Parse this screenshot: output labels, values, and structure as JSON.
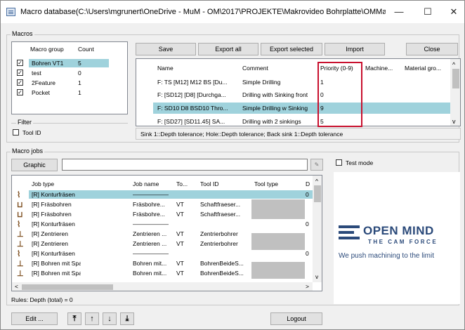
{
  "window": {
    "title": "Macro database(C:\\Users\\mgrunert\\OneDrive - MuM - OM\\2017\\PROJEKTE\\Makrovideo Bohrplatte\\OMMacr...",
    "minimize": "—",
    "maximize": "☐",
    "close": "✕"
  },
  "macros": {
    "label": "Macros",
    "columns": [
      "Macro group",
      "Count"
    ],
    "groups": [
      {
        "name": "Bohren VT1",
        "count": "5",
        "checked": true
      },
      {
        "name": "test",
        "count": "0",
        "checked": true
      },
      {
        "name": "2Feature",
        "count": "1",
        "checked": true
      },
      {
        "name": "Pocket",
        "count": "1",
        "checked": true
      }
    ]
  },
  "filter": {
    "label": "Filter",
    "tool_id": "Tool ID"
  },
  "toolbar": {
    "save": "Save",
    "export_all": "Export all",
    "export_selected": "Export selected",
    "import": "Import",
    "close": "Close"
  },
  "macro_table": {
    "columns": [
      "Name",
      "Comment",
      "Priority (0-9)",
      "Machine...",
      "Material gro..."
    ],
    "rows": [
      {
        "name": "F: TS [M12] M12 BS [Du...",
        "comment": "Simple Drilling",
        "priority": "1"
      },
      {
        "name": "F: [SD12] [D8] [Durchga...",
        "comment": "Drilling with Sinking front",
        "priority": "0"
      },
      {
        "name": "F: SD10 D8 BSD10 Thro...",
        "comment": "Simple Drilling w Sinking",
        "priority": "9"
      },
      {
        "name": "F: [SD27] [SD11.45] SA...",
        "comment": "Drilling with 2 sinkings",
        "priority": "5"
      }
    ],
    "status": "Sink 1::Depth tolerance; Hole::Depth tolerance; Back sink 1::Depth tolerance"
  },
  "macro_jobs": {
    "label": "Macro jobs",
    "graphic_button": "Graphic",
    "columns": [
      "Job type",
      "Job name",
      "To...",
      "Tool ID",
      "Tool type",
      "D"
    ],
    "rows": [
      {
        "type": "[R] Konturfräsen",
        "name": "——————",
        "to": "",
        "tool_id": "",
        "tool_type": "",
        "d": "0",
        "icon": "contour-milling-icon"
      },
      {
        "type": "[R] Fräsbohren",
        "name": "Fräsbohre...",
        "to": "VT",
        "tool_id": "Schaftfraeser...",
        "tool_type": "",
        "d": "",
        "icon": "mill-drilling-icon"
      },
      {
        "type": "[R] Fräsbohren",
        "name": "Fräsbohre...",
        "to": "VT",
        "tool_id": "Schaftfraeser...",
        "tool_type": "",
        "d": "",
        "icon": "mill-drilling-icon"
      },
      {
        "type": "[R] Konturfräsen",
        "name": "——————",
        "to": "",
        "tool_id": "",
        "tool_type": "",
        "d": "0",
        "icon": "contour-milling-icon"
      },
      {
        "type": "[R] Zentrieren",
        "name": "Zentrieren ...",
        "to": "VT",
        "tool_id": "Zentrierbohrer",
        "tool_type": "",
        "d": "",
        "icon": "centering-icon"
      },
      {
        "type": "[R] Zentrieren",
        "name": "Zentrieren ...",
        "to": "VT",
        "tool_id": "Zentrierbohrer",
        "tool_type": "",
        "d": "",
        "icon": "centering-icon"
      },
      {
        "type": "[R] Konturfräsen",
        "name": "——————",
        "to": "",
        "tool_id": "",
        "tool_type": "",
        "d": "0",
        "icon": "contour-milling-icon"
      },
      {
        "type": "[R] Bohren mit Spanbrechen",
        "name": "Bohren mit...",
        "to": "VT",
        "tool_id": "BohrenBeideS...",
        "tool_type": "",
        "d": "",
        "icon": "chip-breaking-drill-icon"
      },
      {
        "type": "[R] Bohren mit Spanbrechen",
        "name": "Bohren mit...",
        "to": "VT",
        "tool_id": "BohrenBeideS...",
        "tool_type": "",
        "d": "",
        "icon": "chip-breaking-drill-icon"
      }
    ],
    "rules": "Rules: Depth (total) = 0"
  },
  "test_mode": "Test mode",
  "brand": {
    "name": "OPEN MIND",
    "tagline": "THE CAM FORCE",
    "slogan": "We push machining to the limit",
    "color": "#2b4a7a"
  },
  "bottom": {
    "edit": "Edit ...",
    "logout": "Logout"
  },
  "colors": {
    "selection": "#9fd2dc",
    "highlight_box": "#c8102e"
  }
}
